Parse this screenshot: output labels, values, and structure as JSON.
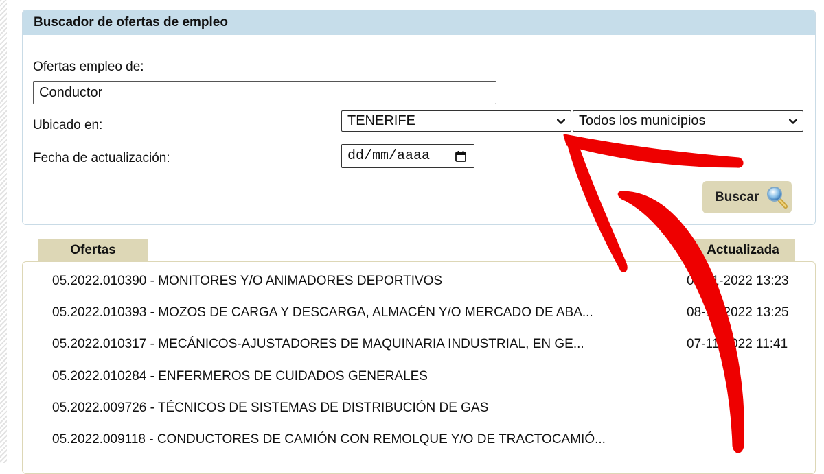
{
  "search": {
    "header": "Buscador de ofertas de empleo",
    "keyword_label": "Ofertas empleo de:",
    "keyword_value": "Conductor",
    "location_label": "Ubicado en:",
    "province_value": "TENERIFE",
    "municipality_value": "Todos los municipios",
    "date_label": "Fecha de actualización:",
    "date_placeholder": "dd/mm/aaaa",
    "button_label": "Buscar"
  },
  "results": {
    "tab_offers": "Ofertas",
    "tab_updated": "Actualizada",
    "rows": [
      {
        "offer": "05.2022.010390 - MONITORES Y/O ANIMADORES DEPORTIVOS",
        "date": "08-11-2022 13:23"
      },
      {
        "offer": "05.2022.010393 - MOZOS DE CARGA Y DESCARGA, ALMACÉN Y/O MERCADO DE ABA...",
        "date": "08-11-2022 13:25"
      },
      {
        "offer": "05.2022.010317 - MECÁNICOS-AJUSTADORES DE MAQUINARIA INDUSTRIAL, EN GE...",
        "date": "07-11-2022 11:41"
      },
      {
        "offer": "05.2022.010284 - ENFERMEROS DE CUIDADOS GENERALES",
        "date": ""
      },
      {
        "offer": "05.2022.009726 - TÉCNICOS DE SISTEMAS DE DISTRIBUCIÓN DE GAS",
        "date": ""
      },
      {
        "offer": "05.2022.009118 - CONDUCTORES DE CAMIÓN CON REMOLQUE Y/O DE TRACTOCAMIÓ...",
        "date": ""
      }
    ]
  },
  "colors": {
    "panel_header": "#c6ddea",
    "tab_bg": "#ddd7b6",
    "annotation_arrow": "#ee0000"
  },
  "icons": {
    "select_arrow": "chevron-down-icon",
    "date_picker": "calendar-icon",
    "search": "magnifier-icon",
    "annotation": "red-arrow-annotation"
  }
}
